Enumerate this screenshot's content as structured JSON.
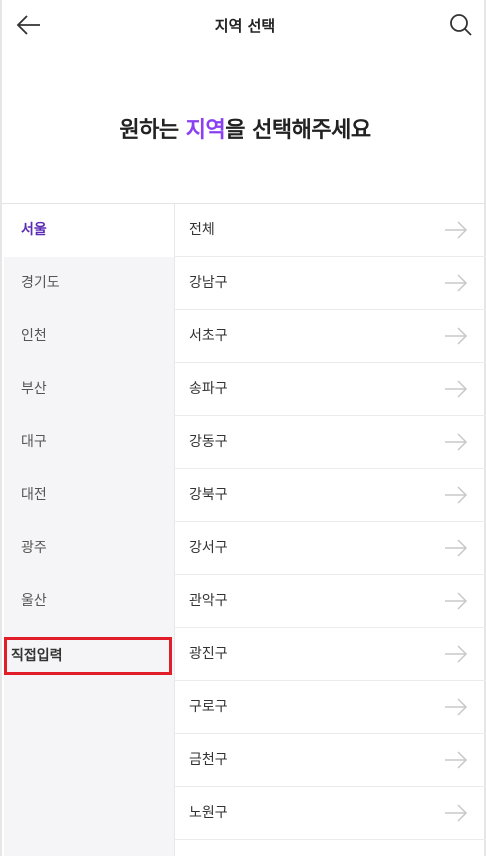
{
  "header": {
    "title": "지역 선택",
    "back_icon": "arrow-left-icon",
    "search_icon": "search-icon"
  },
  "heading": {
    "prefix": "원하는 ",
    "accent": "지역",
    "suffix": "을 선택해주세요",
    "accent_color": "#8a3ff2"
  },
  "regions": [
    {
      "label": "서울",
      "selected": true
    },
    {
      "label": "경기도",
      "selected": false
    },
    {
      "label": "인천",
      "selected": false
    },
    {
      "label": "부산",
      "selected": false
    },
    {
      "label": "대구",
      "selected": false
    },
    {
      "label": "대전",
      "selected": false
    },
    {
      "label": "광주",
      "selected": false
    },
    {
      "label": "울산",
      "selected": false
    },
    {
      "label": "직접입력",
      "selected": false,
      "highlighted": true
    }
  ],
  "districts": [
    {
      "label": "전체"
    },
    {
      "label": "강남구"
    },
    {
      "label": "서초구"
    },
    {
      "label": "송파구"
    },
    {
      "label": "강동구"
    },
    {
      "label": "강북구"
    },
    {
      "label": "강서구"
    },
    {
      "label": "관악구"
    },
    {
      "label": "광진구"
    },
    {
      "label": "구로구"
    },
    {
      "label": "금천구"
    },
    {
      "label": "노원구"
    }
  ],
  "colors": {
    "selected_region": "#5b2bb5",
    "left_panel_bg": "#f5f5f7",
    "highlight_border": "#e11d2a"
  }
}
